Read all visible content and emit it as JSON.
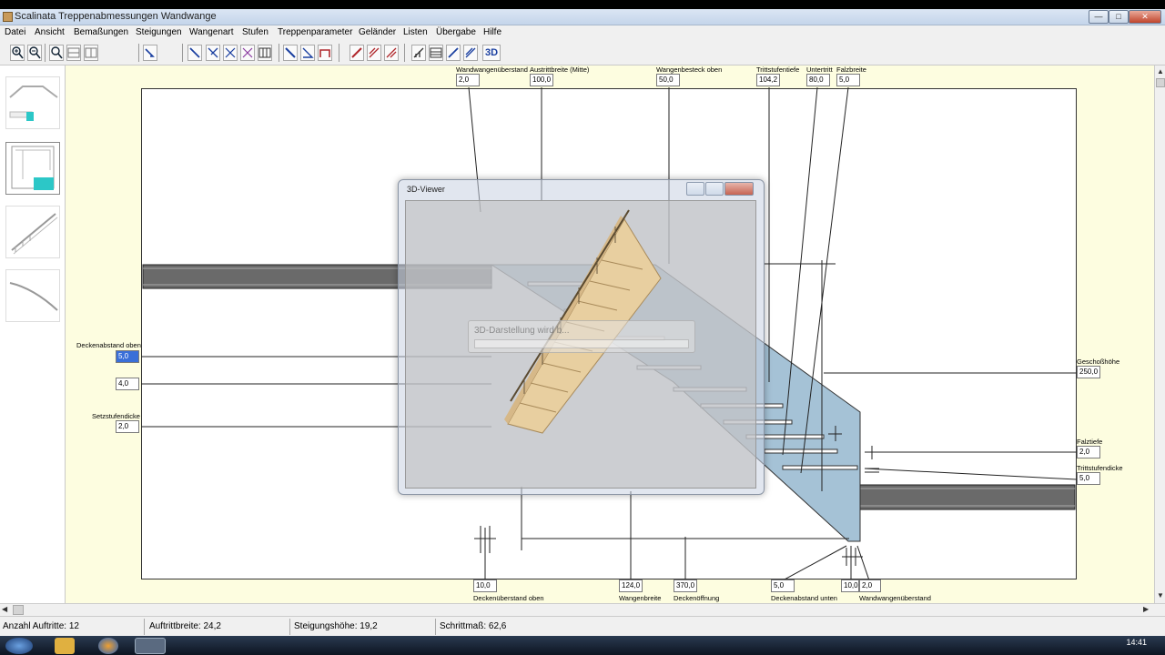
{
  "window": {
    "title": "Scalinata Treppenabmessungen Wandwange",
    "buttons": {
      "minimize": "—",
      "maximize": "□",
      "close": "✕"
    }
  },
  "menu": [
    "Datei",
    "Ansicht",
    "Bemaßungen",
    "Steigungen",
    "Wangenart",
    "Stufen",
    "Treppenparameter",
    "Geländer",
    "Listen",
    "Übergabe",
    "Hilfe"
  ],
  "toolbar": {
    "three_d_label": "3D"
  },
  "top_fields": [
    {
      "label": "Wandwangenüberstand",
      "value": "2,0"
    },
    {
      "label": "Austrittbreite (Mitte)",
      "value": "100,0"
    },
    {
      "label": "Wangenbesteck oben",
      "value": "50,0"
    },
    {
      "label": "Trittstufentiefe",
      "value": "104,2"
    },
    {
      "label": "Untertritt",
      "value": "80,0"
    },
    {
      "label": "Falzbreite",
      "value": "5,0"
    }
  ],
  "left_fields": [
    {
      "label": "Deckenabstand oben",
      "value": "5,0"
    },
    {
      "label": "",
      "value": "4,0"
    },
    {
      "label": "Setzstufendicke",
      "value": "2,0"
    }
  ],
  "right_fields": [
    {
      "label": "Geschoßhöhe",
      "value": "250,0"
    },
    {
      "label": "Falztiefe",
      "value": "2,0"
    },
    {
      "label": "Trittstufendicke",
      "value": "5,0"
    }
  ],
  "bottom_fields": [
    {
      "label": "Deckenüberstand oben",
      "value": "10,0"
    },
    {
      "label": "Wangenbreite",
      "value": "124,0"
    },
    {
      "label": "Deckenöffnung",
      "value": "370,0"
    },
    {
      "label": "Deckenabstand unten",
      "value": "5,0"
    },
    {
      "label": "",
      "value": "10,0"
    },
    {
      "label": "Wandwangenüberstand",
      "value": "2,0"
    }
  ],
  "viewer": {
    "title": "3D-Viewer",
    "loading_text": "3D-Darstellung wird b..."
  },
  "status": {
    "anzahl": "Anzahl Auftritte: 12",
    "auftrittbreite": "Auftrittbreite: 24,2",
    "steigungshoehe": "Steigungshöhe: 19,2",
    "schrittmass": "Schrittmaß: 62,6"
  },
  "taskbar": {
    "time": "14:41"
  }
}
